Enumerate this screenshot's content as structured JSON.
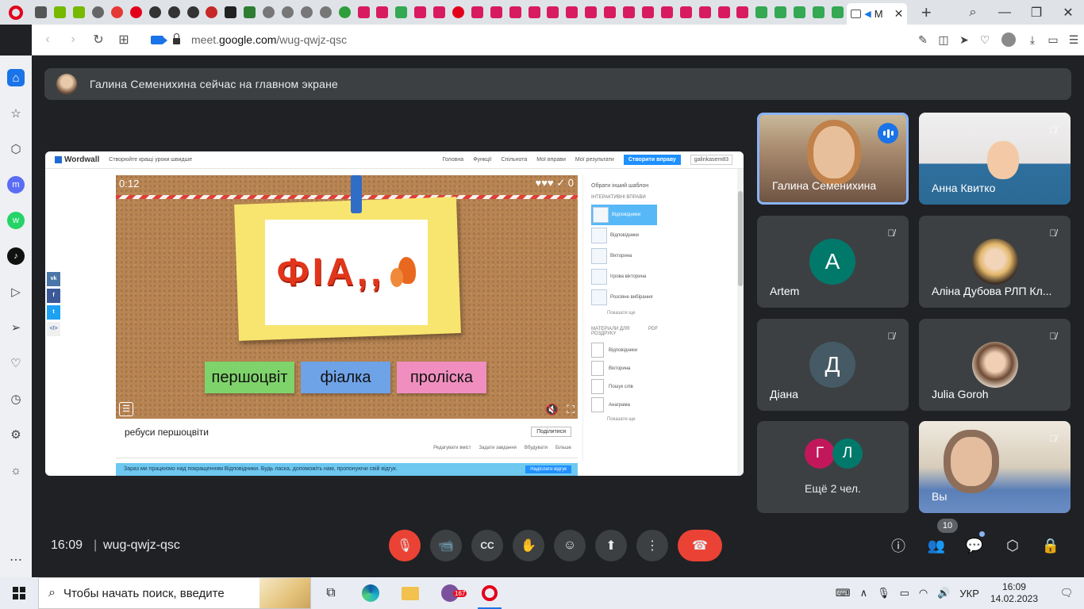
{
  "browser": {
    "tab_title": "M",
    "url_prefix": "meet.",
    "url_domain": "google.com",
    "url_path": "/wug-qwjz-qsc"
  },
  "meet": {
    "presenter_text": "Галина Семенихина сейчас на главном экране",
    "time": "16:09",
    "separator": "|",
    "meeting_code": "wug-qwjz-qsc",
    "people_count": "10"
  },
  "shared_screen": {
    "logo": "Wordwall",
    "tagline": "Створюйте кращі уроки швидше",
    "nav": [
      "Головна",
      "Функції",
      "Спільнота",
      "Мої вправи",
      "Мої результати"
    ],
    "create_button": "Створити вправу",
    "user_button": "galinkasem83",
    "game": {
      "timer": "0:12",
      "lives": "♥♥♥ ✓ 0",
      "rebus_text": "ФІА,,",
      "answers": [
        "першоцвіт",
        "фіалка",
        "проліска"
      ]
    },
    "activity_title": "ребуси першоцвіти",
    "share_label": "Поділитися",
    "actions": [
      "Редагувати вміст",
      "Задати завдання",
      "Вбудувати",
      "Більше"
    ],
    "feedback_text": "Зараз ми працюємо над покращенням Відповідники. Будь ласка, допоможіть нам, пропонуючи свій відгук.",
    "feedback_button": "Надіслати відгук",
    "side": {
      "switch_template": "Обрати інший шаблон",
      "interactive_caption": "ІНТЕРАКТИВНІ ВПРАВИ",
      "templates": [
        "Відповідники",
        "Відповідники",
        "Вікторина",
        "Ігрова вікторина",
        "Розсіяне вибірання"
      ],
      "show_more": "Показати ще",
      "printables_caption": "МАТЕРІАЛИ ДЛЯ РОЗДРУКУ",
      "pdf": "PDF",
      "printables": [
        "Відповідники",
        "Вікторина",
        "Пошук слів",
        "Анаграма"
      ],
      "show_more_2": "Показати ще"
    }
  },
  "participants": [
    {
      "name": "Галина Семенихина",
      "speaking": true
    },
    {
      "name": "Анна Квитко"
    },
    {
      "name": "Artem",
      "initial": "A",
      "color": "#00796b"
    },
    {
      "name": "Аліна Дубова РЛП Кл..."
    },
    {
      "name": "Діана",
      "initial": "Д",
      "color": "#455a64"
    },
    {
      "name": "Julia Goroh"
    },
    {
      "more_text": "Ещё 2 чел.",
      "initials": [
        "Г",
        "Л"
      ]
    },
    {
      "name": "Вы"
    }
  ],
  "taskbar": {
    "search_placeholder": "Чтобы начать поиск, введите",
    "viber_badge": "167",
    "language": "УКР",
    "clock_time": "16:09",
    "clock_date": "14.02.2023"
  },
  "colors": {
    "meet_bg": "#202124",
    "tile_bg": "#3c4043",
    "danger": "#ea4335",
    "accent": "#1a73e8"
  }
}
